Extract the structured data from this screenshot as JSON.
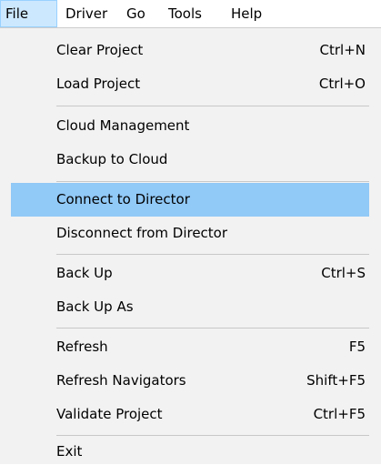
{
  "menubar": {
    "items": [
      {
        "label": "File"
      },
      {
        "label": "Driver"
      },
      {
        "label": "Go"
      },
      {
        "label": "Tools"
      },
      {
        "label": "Help"
      }
    ]
  },
  "file_menu": {
    "items": [
      {
        "label": "Clear Project",
        "shortcut": "Ctrl+N"
      },
      {
        "label": "Load Project",
        "shortcut": "Ctrl+O"
      },
      {
        "label": "Cloud Management",
        "shortcut": ""
      },
      {
        "label": "Backup to Cloud",
        "shortcut": ""
      },
      {
        "label": "Connect to Director",
        "shortcut": ""
      },
      {
        "label": "Disconnect from Director",
        "shortcut": ""
      },
      {
        "label": "Back Up",
        "shortcut": "Ctrl+S"
      },
      {
        "label": "Back Up As",
        "shortcut": ""
      },
      {
        "label": "Refresh",
        "shortcut": "F5"
      },
      {
        "label": "Refresh Navigators",
        "shortcut": "Shift+F5"
      },
      {
        "label": "Validate Project",
        "shortcut": "Ctrl+F5"
      },
      {
        "label": "Exit",
        "shortcut": ""
      }
    ]
  },
  "colors": {
    "highlight": "#91c9f7",
    "menu_background": "#f2f2f2",
    "active_menubar": "#cce8ff"
  }
}
